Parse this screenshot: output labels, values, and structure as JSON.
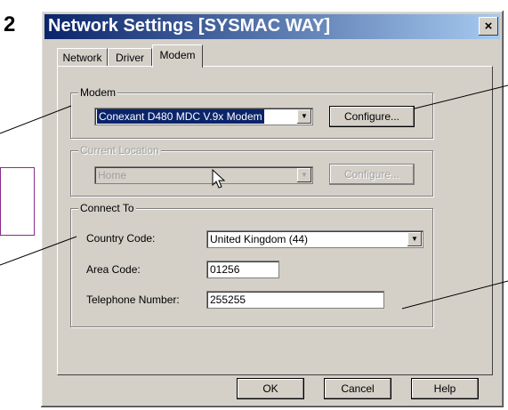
{
  "step_number": "2",
  "window": {
    "title": "Network Settings [SYSMAC WAY]",
    "close_label": "×"
  },
  "tabs": [
    {
      "label": "Network"
    },
    {
      "label": "Driver"
    },
    {
      "label": "Modem"
    }
  ],
  "active_tab": "Modem",
  "modem_group": {
    "title": "Modem",
    "selected_modem": "Conexant D480 MDC V.9x Modem",
    "configure_label": "Configure..."
  },
  "location_group": {
    "title": "Current Location",
    "selected_location": "Home",
    "configure_label": "Configure...",
    "disabled": true
  },
  "connect_group": {
    "title": "Connect To",
    "country_label": "Country Code:",
    "country_value": "United Kingdom (44)",
    "area_label": "Area Code:",
    "area_value": "01256",
    "phone_label": "Telephone Number:",
    "phone_value": "255255"
  },
  "footer": {
    "ok_label": "OK",
    "cancel_label": "Cancel",
    "help_label": "Help"
  },
  "colors": {
    "title_gradient_start": "#0a246a",
    "title_gradient_end": "#a6caf0",
    "dialog_face": "#d4d0c8",
    "callout_border": "#8a2b8a"
  }
}
